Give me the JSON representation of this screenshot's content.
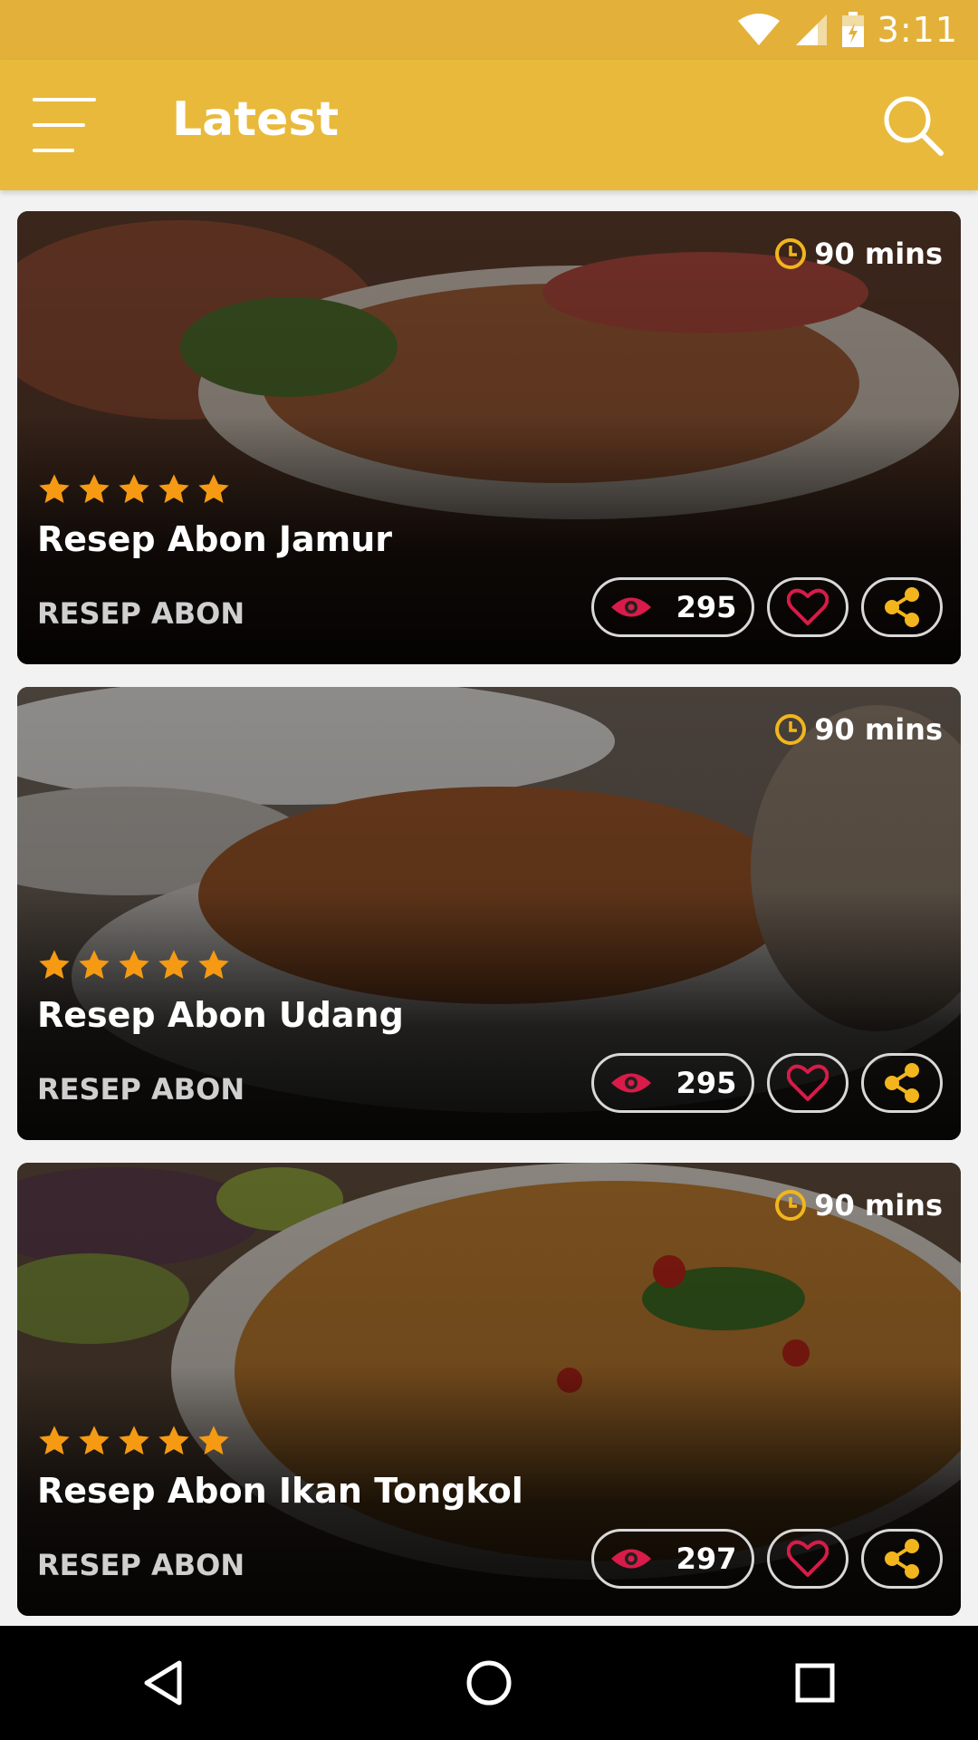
{
  "status_bar": {
    "time": "3:11"
  },
  "app_bar": {
    "title": "Latest"
  },
  "recipes": [
    {
      "title": "Resep Abon Jamur",
      "category": "RESEP ABON",
      "time": "90 mins",
      "views": "295",
      "rating": 5,
      "rating_max": 5
    },
    {
      "title": "Resep Abon Udang",
      "category": "RESEP ABON",
      "time": "90 mins",
      "views": "295",
      "rating": 5,
      "rating_max": 5
    },
    {
      "title": "Resep Abon Ikan Tongkol",
      "category": "RESEP ABON",
      "time": "90 mins",
      "views": "297",
      "rating": 5,
      "rating_max": 5
    }
  ],
  "colors": {
    "accent": "#e8b93b",
    "star": "#f59a12",
    "eye": "#d81b48",
    "heart": "#d81b48",
    "share": "#f2b51d"
  },
  "icons": [
    "menu-icon",
    "search-icon",
    "wifi-icon",
    "signal-icon",
    "battery-icon",
    "clock-icon",
    "star-icon",
    "eye-icon",
    "heart-icon",
    "share-icon",
    "back-icon",
    "home-icon",
    "recents-icon"
  ]
}
